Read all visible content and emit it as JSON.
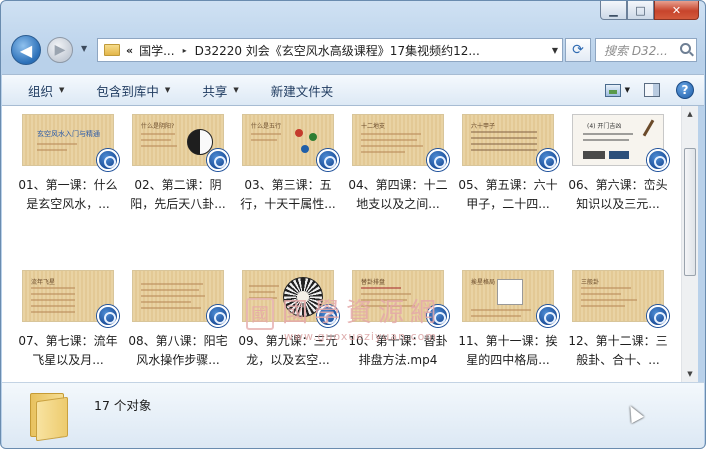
{
  "window": {
    "caption": {
      "minimize_glyph": "▁",
      "maximize_glyph": "□",
      "close_glyph": "✕"
    }
  },
  "nav": {
    "back_glyph": "◀",
    "forward_glyph": "▶",
    "history_glyph": "▼"
  },
  "address": {
    "overflow": "«",
    "segments": [
      "国学...",
      "D32220 刘会《玄空风水高级课程》17集视频约12..."
    ],
    "separator": "▸",
    "dropdown_glyph": "▼"
  },
  "refresh_glyph": "⟳",
  "search": {
    "placeholder": "搜索 D32..."
  },
  "toolbar": {
    "organize": "组织",
    "include_in_library": "包含到库中",
    "share": "共享",
    "new_folder": "新建文件夹",
    "menu_arrow": "▼",
    "help_glyph": "?"
  },
  "files": [
    {
      "label": "01、第一课：什么是玄空风水，...",
      "thumb_title": "玄空风水入门与精通"
    },
    {
      "label": "02、第二课：阴阳，先后天八卦...",
      "thumb_title": "什么是阴阳?"
    },
    {
      "label": "03、第三课：五行，十天干属性...",
      "thumb_title": "什么是五行"
    },
    {
      "label": "04、第四课：十二地支以及之间...",
      "thumb_title": "十二地支"
    },
    {
      "label": "05、第五课：六十甲子，二十四...",
      "thumb_title": "六十甲子"
    },
    {
      "label": "06、第六课：峦头知识以及三元...",
      "thumb_title": "(4) 开门吉凶"
    },
    {
      "label": "07、第七课：流年飞星以及月...",
      "thumb_title": "流年飞星"
    },
    {
      "label": "08、第八课：阳宅风水操作步骤...",
      "thumb_title": ""
    },
    {
      "label": "09、第九课：三元龙，以及玄空...",
      "thumb_title": ""
    },
    {
      "label": "10、第十课：替卦排盘方法.mp4",
      "thumb_title": "替卦排盘"
    },
    {
      "label": "11、第十一课：挨星的四中格局...",
      "thumb_title": "挨星格局"
    },
    {
      "label": "12、第十二课：三般卦、合十、...",
      "thumb_title": "三般卦"
    }
  ],
  "scrollbar": {
    "up_glyph": "▲",
    "down_glyph": "▼"
  },
  "watermark": {
    "seal": "國",
    "text": "國學資源網",
    "url": "www.guoxueziyuan.com"
  },
  "details": {
    "count": "17 个对象"
  }
}
